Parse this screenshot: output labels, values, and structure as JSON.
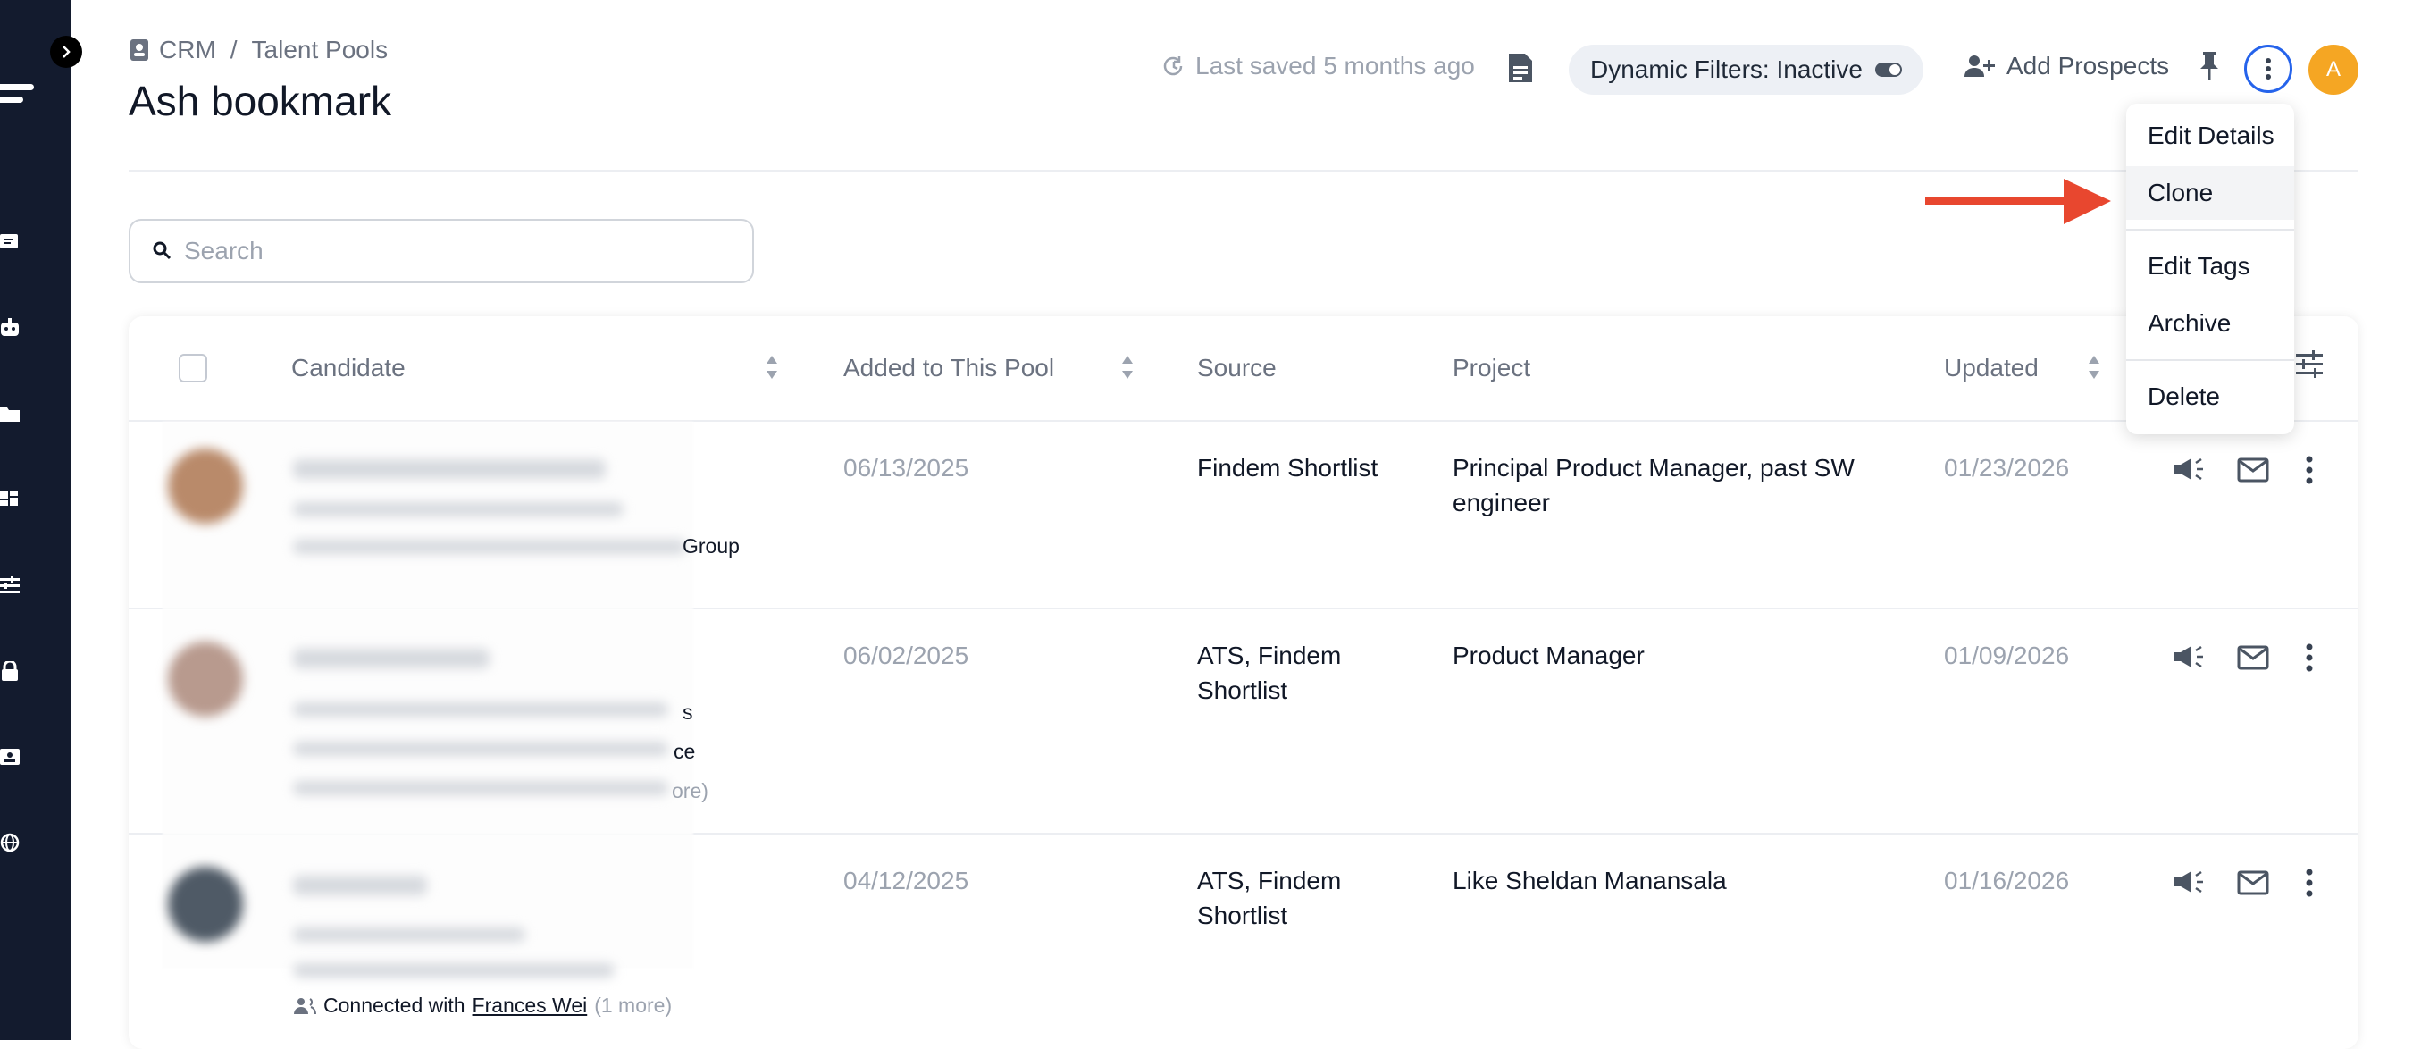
{
  "breadcrumb": {
    "root": "CRM",
    "separator": "/",
    "current": "Talent Pools"
  },
  "page_title": "Ash bookmark",
  "header": {
    "last_saved": "Last saved 5 months ago",
    "dynamic_filters": "Dynamic Filters: Inactive",
    "add_prospects": "Add Prospects",
    "avatar_initial": "A"
  },
  "search": {
    "placeholder": "Search",
    "value": ""
  },
  "table": {
    "columns": {
      "candidate": "Candidate",
      "added": "Added to This Pool",
      "source": "Source",
      "project": "Project",
      "updated": "Updated"
    },
    "rows": [
      {
        "added": "06/13/2025",
        "source": "Findem Shortlist",
        "project": "Principal Product Manager, past SW engineer",
        "updated": "01/23/2026",
        "partial_text": [
          "Group"
        ]
      },
      {
        "added": "06/02/2025",
        "source": "ATS, Findem Shortlist",
        "project": "Product Manager",
        "updated": "01/09/2026",
        "partial_text": [
          "s",
          "ce",
          "ore)"
        ]
      },
      {
        "added": "04/12/2025",
        "source": "ATS, Findem Shortlist",
        "project": "Like Sheldan Manansala",
        "updated": "01/16/2026",
        "connected": {
          "prefix": "Connected with",
          "name": "Frances Wei",
          "more": "(1 more)"
        }
      }
    ]
  },
  "menu": {
    "items": [
      "Edit Details",
      "Clone",
      "Edit Tags",
      "Archive",
      "Delete"
    ]
  },
  "colors": {
    "sidebar": "#131b2e",
    "accent": "#2563eb",
    "avatar": "#f5a623",
    "arrow": "#e8472f"
  }
}
